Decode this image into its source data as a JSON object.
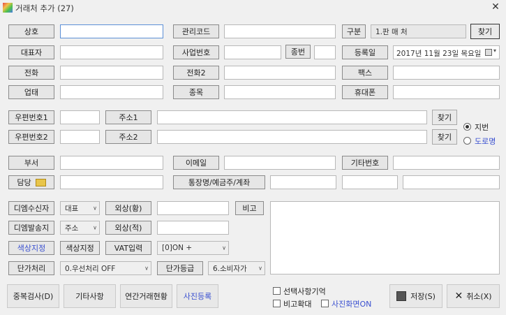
{
  "window": {
    "title": "거래처 추가 (27)",
    "close_label": "✕"
  },
  "labels": {
    "name": "상호",
    "manage_code": "관리코드",
    "category": "구분",
    "ceo": "대표자",
    "biz_no": "사업번호",
    "sub_no": "종번",
    "reg_date": "등록일",
    "phone": "전화",
    "phone2": "전화2",
    "fax": "팩스",
    "biz_type": "업태",
    "biz_item": "종목",
    "mobile": "휴대폰",
    "zip1": "우편번호1",
    "addr1": "주소1",
    "zip2": "우편번호2",
    "addr2": "주소2",
    "dept": "부서",
    "email": "이메일",
    "etc_no": "기타번호",
    "manager": "담당",
    "bank": "통장명/예금주/계좌",
    "dm_receiver": "디엠수신자",
    "balance_receivable": "외상(황)",
    "memo": "비고",
    "dm_sender": "디엠발송지",
    "balance_payable": "외상(적)",
    "color_set": "색상지정",
    "color_set2": "색상지정",
    "vat_input": "VAT입력",
    "unit_price_proc": "단가처리",
    "unit_price_grade": "단가등급"
  },
  "values": {
    "category": "1.판 매 처",
    "reg_date": "2017년 11월 23일 목요일",
    "dm_receiver_sel": "대표",
    "dm_sender_sel": "주소",
    "vat_sel": "[0]ON +",
    "unit_price_proc_sel": "0.우선처리 OFF",
    "unit_price_grade_sel": "6.소비자가"
  },
  "buttons": {
    "find": "찾기",
    "find_addr1": "찾기",
    "find_addr2": "찾기",
    "dup_check": "중복검사(D)",
    "etc_items": "기타사항",
    "annual": "연간거래현황",
    "photo": "사진등록",
    "save": "저장(S)",
    "cancel": "취소(X)"
  },
  "radios": {
    "jibun": "지번",
    "road": "도로명"
  },
  "checks": {
    "remember": "선택사항기억",
    "memo_zoom": "비고확대",
    "photo_screen": "사진화면ON"
  },
  "colors": {
    "accent_blue": "#3a50d0",
    "focus_border": "#5b8fd6"
  }
}
